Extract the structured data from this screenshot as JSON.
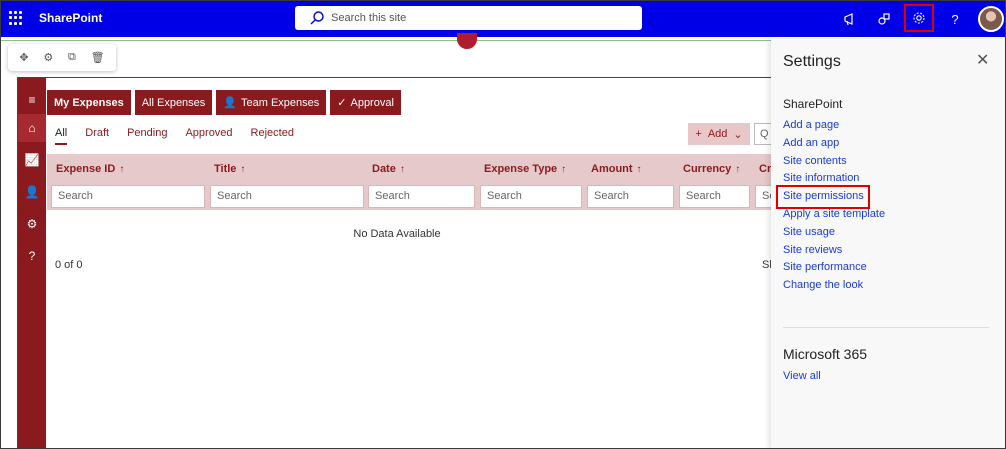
{
  "suite": {
    "brand": "SharePoint",
    "search_placeholder": "Search this site"
  },
  "app": {
    "tabs": [
      {
        "label": "My Expenses"
      },
      {
        "label": "All Expenses"
      },
      {
        "label": "Team Expenses"
      },
      {
        "label": "Approval"
      }
    ],
    "subtabs": [
      "All",
      "Draft",
      "Pending",
      "Approved",
      "Rejected"
    ],
    "add_label": "Add",
    "search_stub": "Q",
    "columns": [
      "Expense ID",
      "Title",
      "Date",
      "Expense Type",
      "Amount",
      "Currency",
      "Cr"
    ],
    "filter_placeholder": "Search",
    "filter_stub": "Se",
    "no_data": "No Data Available",
    "count": "0 of 0",
    "show_stub": "Sh"
  },
  "settings": {
    "title": "Settings",
    "section_sharepoint": "SharePoint",
    "links": [
      "Add a page",
      "Add an app",
      "Site contents",
      "Site information",
      "Site permissions",
      "Apply a site template",
      "Site usage",
      "Site reviews",
      "Site performance",
      "Change the look"
    ],
    "section_m365": "Microsoft 365",
    "view_all": "View all"
  },
  "colors": {
    "suite_bar": "#0000e6",
    "app_accent": "#8b1a1f",
    "highlight": "#e00000",
    "link": "#1a3bd6"
  }
}
